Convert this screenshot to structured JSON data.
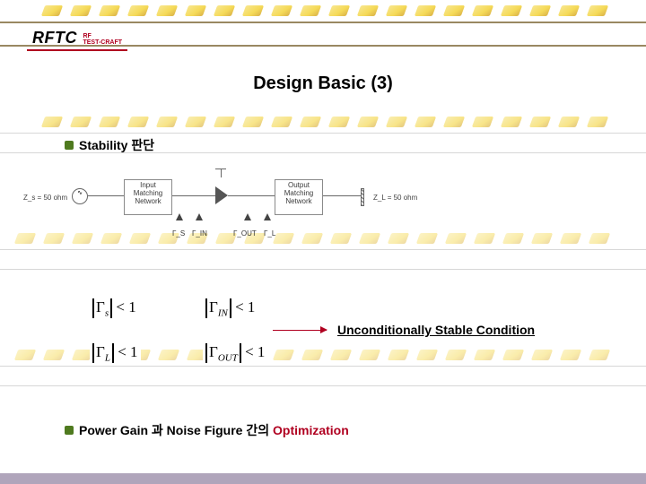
{
  "logo": {
    "main": "RFTC",
    "sub1": "RF",
    "sub2": "TEST-CRAFT"
  },
  "title": "Design Basic (3)",
  "bullets": {
    "stability": "Stability 판단",
    "gain_noise_prefix": "Power Gain 과 Noise Figure 간의 ",
    "optimization": "Optimization"
  },
  "diagram": {
    "zsource": "Z_s = 50 ohm",
    "zload": "Z_L = 50 ohm",
    "input_box_l1": "Input",
    "input_box_l2": "Matching",
    "input_box_l3": "Network",
    "output_box_l1": "Output",
    "output_box_l2": "Matching",
    "output_box_l3": "Network",
    "gs": "Γ_S",
    "gin": "Γ_IN",
    "gout": "Γ_OUT",
    "gl": "Γ_L"
  },
  "conditions": {
    "c1_sym": "Γ",
    "c1_sub": "s",
    "c1_ineq": " < 1",
    "c2_sym": "Γ",
    "c2_sub": "IN",
    "c2_ineq": " < 1",
    "c3_sym": "Γ",
    "c3_sub": "L",
    "c3_ineq": " < 1",
    "c4_sym": "Γ",
    "c4_sub": "OUT",
    "c4_ineq": " < 1",
    "label": "Unconditionally Stable Condition"
  }
}
